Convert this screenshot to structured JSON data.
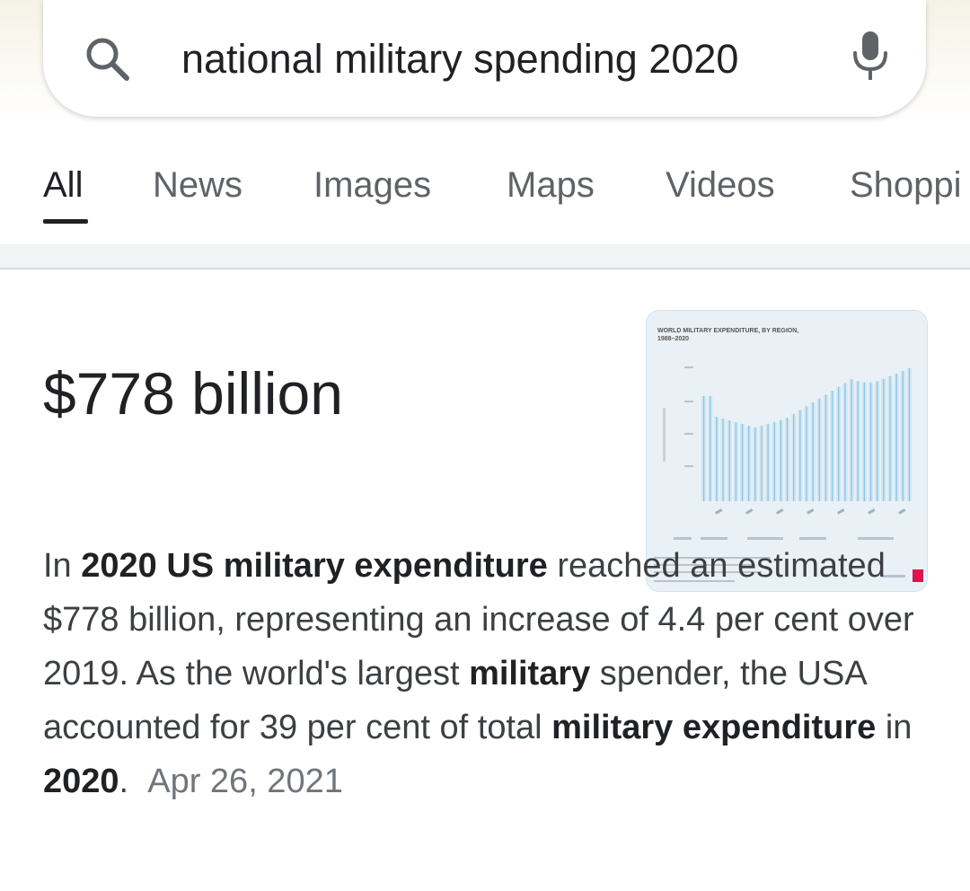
{
  "search": {
    "query": "national military spending 2020"
  },
  "tabs": [
    {
      "label": "All"
    },
    {
      "label": "News"
    },
    {
      "label": "Images"
    },
    {
      "label": "Maps"
    },
    {
      "label": "Videos"
    },
    {
      "label": "Shoppi"
    }
  ],
  "answer": {
    "value": "$778 billion",
    "thumbnail": {
      "title_line1": "WORLD MILITARY EXPENDITURE, BY REGION,",
      "title_line2": "1988–2020"
    }
  },
  "snippet": {
    "s1": "In ",
    "b1": "2020 US military expenditure",
    "s2": " reached an estimated $778 billion, representing an increase of 4.4 per cent over 2019. As the world's largest ",
    "b2": "military",
    "s3": " spender, the USA accounted for 39 per cent of total ",
    "b3": "military expenditure",
    "s4": " in ",
    "b4": "2020",
    "s5": ".",
    "date": "Apr 26, 2021"
  },
  "colors": {
    "link_blue": "#1a73e8",
    "chart_light": "#cfe6f3",
    "chart_mid": "#8fc3e0",
    "accent_red": "#e0134f"
  }
}
